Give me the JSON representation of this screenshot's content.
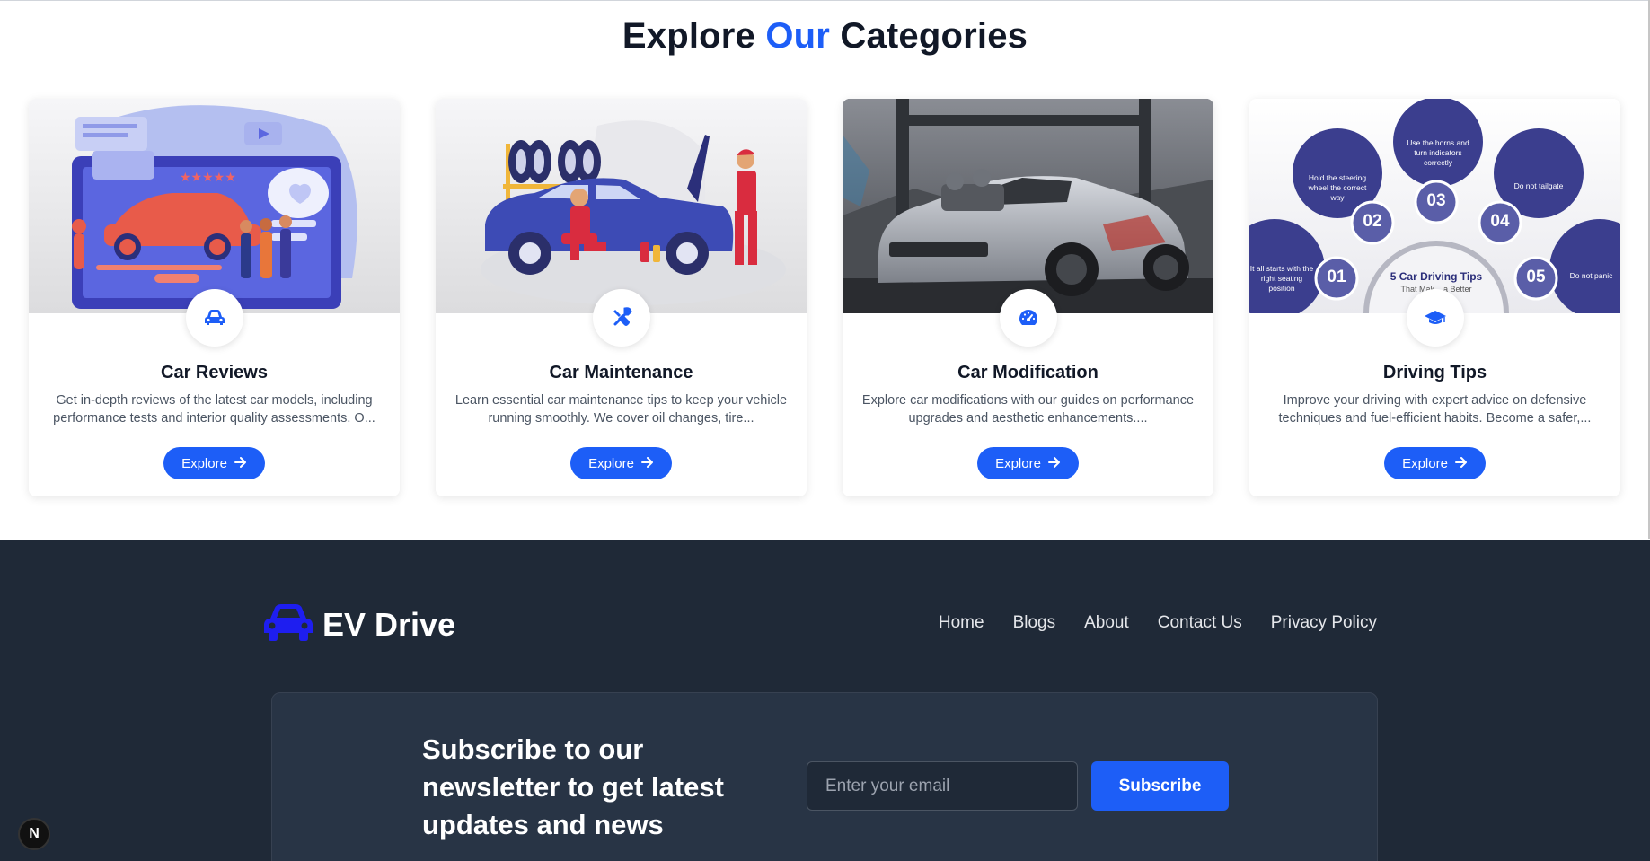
{
  "categories": {
    "title_part1": "Explore",
    "title_accent": "Our",
    "title_part2": "Categories",
    "accent_color": "#1d5ef7",
    "cards": [
      {
        "title": "Car Reviews",
        "icon": "car-icon",
        "description": "Get in-depth reviews of the latest car models, including performance tests and interior quality assessments. O...",
        "button_label": "Explore"
      },
      {
        "title": "Car Maintenance",
        "icon": "tools-icon",
        "description": "Learn essential car maintenance tips to keep your vehicle running smoothly. We cover oil changes, tire...",
        "button_label": "Explore"
      },
      {
        "title": "Car Modification",
        "icon": "speedometer-icon",
        "description": "Explore car modifications with our guides on performance upgrades and aesthetic enhancements....",
        "button_label": "Explore"
      },
      {
        "title": "Driving Tips",
        "icon": "graduation-cap-icon",
        "description": "Improve your driving with expert advice on defensive techniques and fuel-efficient habits. Become a safer,...",
        "button_label": "Explore",
        "infographic": {
          "items": [
            {
              "num": "01",
              "text": "It all starts with the right seating position"
            },
            {
              "num": "02",
              "text": "Hold the steering wheel the correct way"
            },
            {
              "num": "03",
              "text": "Use the horns and turn indicators correctly"
            },
            {
              "num": "04",
              "text": "Do not tailgate"
            },
            {
              "num": "05",
              "text": "Do not panic"
            }
          ],
          "center_title": "5 Car Driving Tips",
          "center_sub": "That Mak... a Better"
        }
      }
    ]
  },
  "footer": {
    "brand": "EV Drive",
    "brand_color": "#1e1ef0",
    "nav": [
      "Home",
      "Blogs",
      "About",
      "Contact Us",
      "Privacy Policy"
    ],
    "newsletter": {
      "heading": "Subscribe to our newsletter to get latest updates and news",
      "placeholder": "Enter your email",
      "button_label": "Subscribe"
    }
  },
  "badge": "N"
}
